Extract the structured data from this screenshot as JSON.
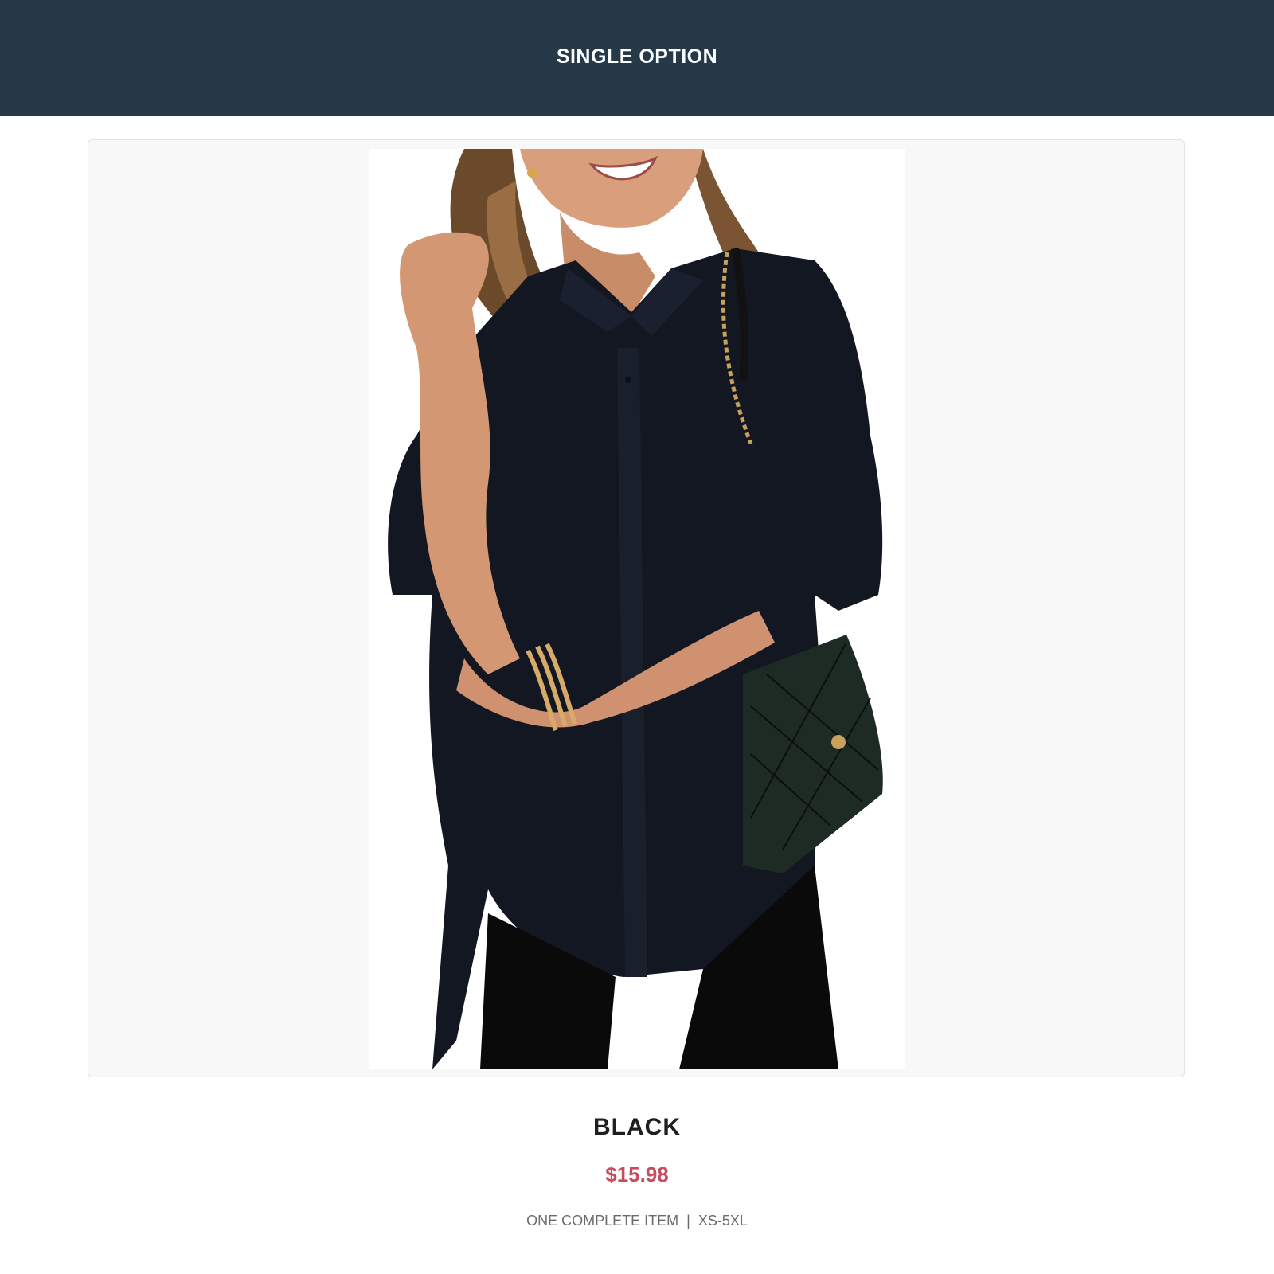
{
  "header": {
    "title": "SINGLE OPTION"
  },
  "product": {
    "image_alt": "Model wearing black short-sleeve button-up blouse with quilted black shoulder bag",
    "variant_name": "BLACK",
    "price": "$15.98",
    "item_type": "ONE COMPLETE ITEM",
    "separator": "|",
    "size_range": "XS-5XL"
  },
  "colors": {
    "header_bg": "#253949",
    "price": "#c94c5e",
    "frame_bg": "#f8f8f8"
  }
}
